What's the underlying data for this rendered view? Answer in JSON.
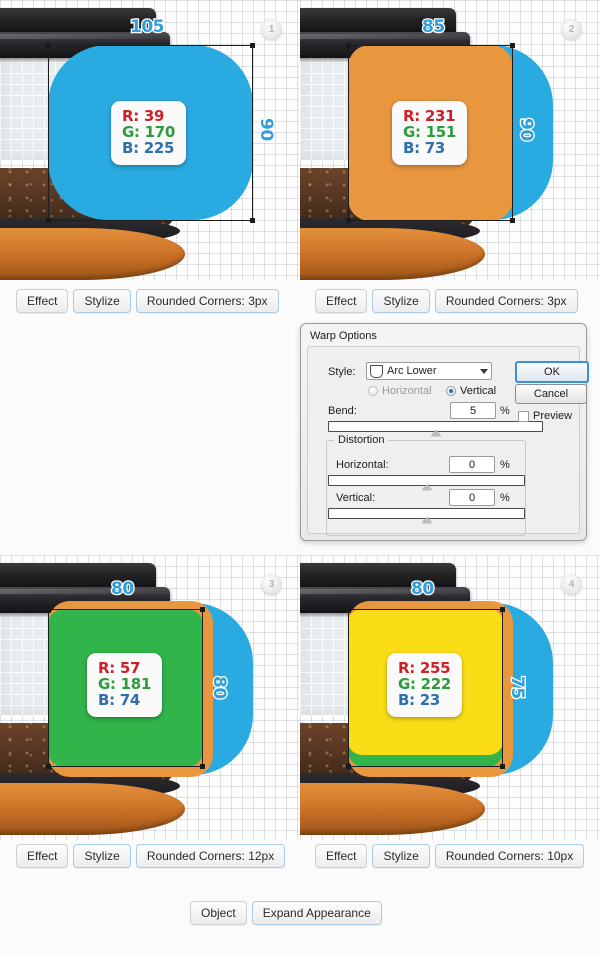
{
  "panels": [
    {
      "badge": "1",
      "top_measure": "105",
      "side_measure": "90",
      "rgb": {
        "r": "R: 39",
        "g": "G: 170",
        "b": "B: 225"
      },
      "crumbs": [
        {
          "label": "Effect",
          "highlight": false
        },
        {
          "label": "Stylize",
          "highlight": true
        },
        {
          "label": "Rounded Corners: 3px",
          "highlight": true
        }
      ]
    },
    {
      "badge": "2",
      "top_measure": "85",
      "side_measure": "90",
      "rgb": {
        "r": "R: 231",
        "g": "G: 151",
        "b": "B: 73"
      },
      "crumbs": [
        {
          "label": "Effect",
          "highlight": false
        },
        {
          "label": "Stylize",
          "highlight": true
        },
        {
          "label": "Rounded Corners: 3px",
          "highlight": true
        }
      ]
    },
    {
      "badge": "3",
      "top_measure": "80",
      "side_measure": "80",
      "rgb": {
        "r": "R: 57",
        "g": "G: 181",
        "b": "B: 74"
      },
      "crumbs": [
        {
          "label": "Effect",
          "highlight": false
        },
        {
          "label": "Stylize",
          "highlight": true
        },
        {
          "label": "Rounded Corners: 12px",
          "highlight": true
        }
      ]
    },
    {
      "badge": "4",
      "top_measure": "80",
      "side_measure": "75",
      "rgb": {
        "r": "R: 255",
        "g": "G: 222",
        "b": "B: 23"
      },
      "crumbs": [
        {
          "label": "Effect",
          "highlight": false
        },
        {
          "label": "Stylize",
          "highlight": true
        },
        {
          "label": "Rounded Corners: 10px",
          "highlight": true
        }
      ]
    }
  ],
  "dialog": {
    "title": "Warp Options",
    "style_label": "Style:",
    "style_value": "Arc Lower",
    "orientation": {
      "horizontal_label": "Horizontal",
      "vertical_label": "Vertical",
      "selected": "Vertical"
    },
    "bend": {
      "label": "Bend:",
      "value": "5",
      "unit": "%"
    },
    "distortion": {
      "legend": "Distortion",
      "horizontal": {
        "label": "Horizontal:",
        "value": "0",
        "unit": "%"
      },
      "vertical": {
        "label": "Vertical:",
        "value": "0",
        "unit": "%"
      }
    },
    "ok_label": "OK",
    "cancel_label": "Cancel",
    "preview_label": "Preview"
  },
  "object_row": [
    {
      "label": "Object",
      "highlight": false
    },
    {
      "label": "Expand Appearance",
      "highlight": true
    }
  ],
  "colors": {
    "blue": "#29abe2",
    "orange": "#e8973f",
    "green": "#31b44a",
    "yellow": "#fbdd17",
    "measure_blue": "#2e9fd8"
  }
}
